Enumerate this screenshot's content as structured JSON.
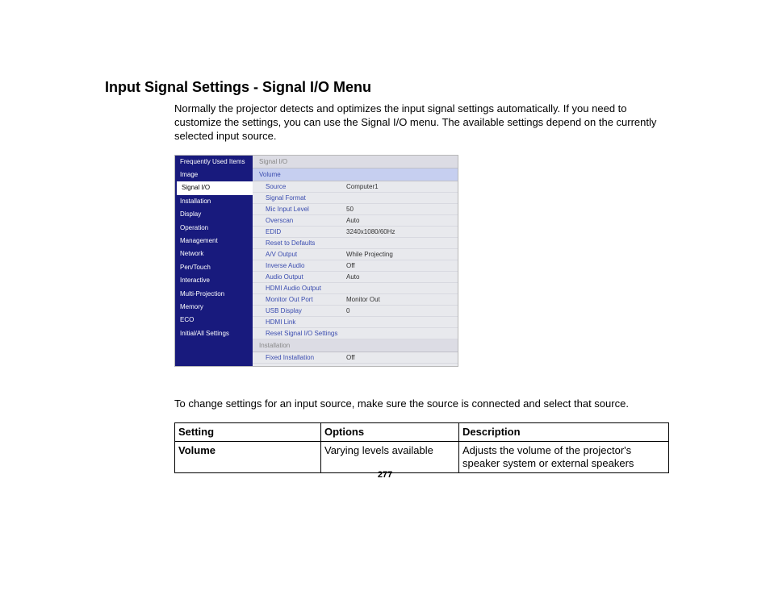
{
  "heading": "Input Signal Settings - Signal I/O Menu",
  "intro": "Normally the projector detects and optimizes the input signal settings automatically. If you need to customize the settings, you can use the Signal I/O menu. The available settings depend on the currently selected input source.",
  "menu": {
    "nav": [
      "Frequently Used Items",
      "Image",
      "Signal I/O",
      "Installation",
      "Display",
      "Operation",
      "Management",
      "Network",
      "Pen/Touch",
      "Interactive",
      "Multi-Projection",
      "Memory",
      "ECO",
      "Initial/All Settings"
    ],
    "selectedIndex": 2,
    "sections": [
      {
        "header": "Signal I/O",
        "highlight": false,
        "rows": []
      },
      {
        "header": "Volume",
        "highlight": true,
        "rows": [
          {
            "label": "Source",
            "value": "Computer1"
          },
          {
            "label": "Signal Format",
            "value": ""
          },
          {
            "label": "Mic Input Level",
            "value": "50"
          },
          {
            "label": "Overscan",
            "value": "Auto"
          },
          {
            "label": "EDID",
            "value": "3240x1080/60Hz"
          },
          {
            "label": "Reset to Defaults",
            "value": ""
          },
          {
            "label": "A/V Output",
            "value": "While Projecting"
          },
          {
            "label": "Inverse Audio",
            "value": "Off"
          },
          {
            "label": "Audio Output",
            "value": "Auto"
          },
          {
            "label": "HDMI Audio Output",
            "value": ""
          },
          {
            "label": "Monitor Out Port",
            "value": "Monitor Out"
          },
          {
            "label": "USB Display",
            "value": "0"
          },
          {
            "label": "HDMI Link",
            "value": ""
          },
          {
            "label": "Reset Signal I/O Settings",
            "value": ""
          }
        ]
      },
      {
        "header": "Installation",
        "highlight": false,
        "rows": [
          {
            "label": "Fixed Installation",
            "value": "Off"
          }
        ]
      }
    ]
  },
  "lead2": "To change settings for an input source, make sure the source is connected and select that source.",
  "table": {
    "headers": [
      "Setting",
      "Options",
      "Description"
    ],
    "rows": [
      {
        "setting": "Volume",
        "options": "Varying levels available",
        "desc": "Adjusts the volume of the projector's speaker system or external speakers"
      }
    ]
  },
  "pageNumber": "277"
}
